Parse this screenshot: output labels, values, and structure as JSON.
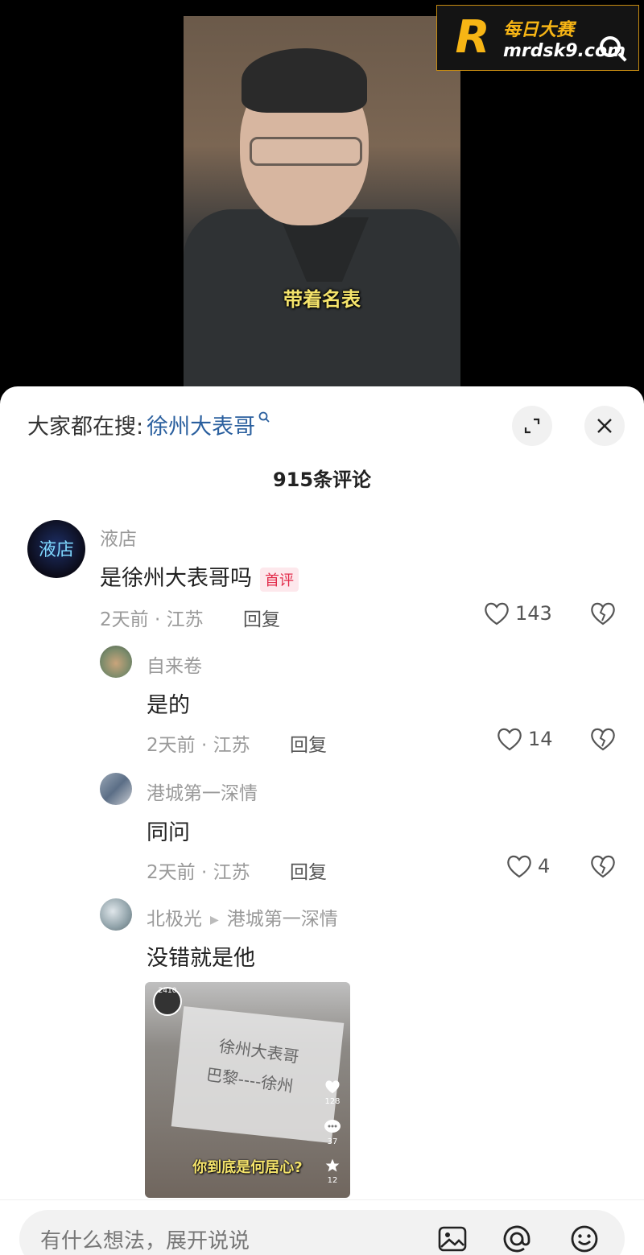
{
  "video": {
    "caption": "带着名表",
    "watermark": {
      "brand_cn": "每日大赛",
      "domain": "mrdsk9.com"
    }
  },
  "sheet": {
    "search_prefix": "大家都在搜:",
    "search_term": "徐州大表哥",
    "comment_count": "915条评论"
  },
  "comments": [
    {
      "user": "液店",
      "text": "是徐州大表哥吗",
      "badge": "首评",
      "time_location": "2天前 · 江苏",
      "reply": "回复",
      "likes": "143"
    },
    {
      "user": "自来卷",
      "text": "是的",
      "time_location": "2天前 · 江苏",
      "reply": "回复",
      "likes": "14"
    },
    {
      "user": "港城第一深情",
      "text": "同问",
      "time_location": "2天前 · 江苏",
      "reply": "回复",
      "likes": "4"
    },
    {
      "user": "北极光",
      "reply_to": "港城第一深情",
      "text": "没错就是他",
      "thumbnail": {
        "sign_line1": "徐州大表哥",
        "sign_line2": "巴黎----徐州",
        "caption": "你到底是何居心?",
        "avatar_count": "2410",
        "like_count": "128",
        "comment_count": "37",
        "fav_count": "12"
      }
    }
  ],
  "composer": {
    "placeholder": "有什么想法，展开说说"
  }
}
